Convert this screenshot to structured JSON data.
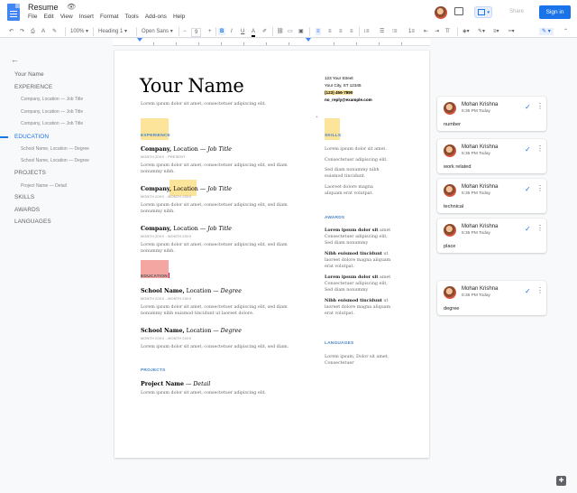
{
  "app": {
    "doc_title": "Resume",
    "menu": [
      "File",
      "Edit",
      "View",
      "Insert",
      "Format",
      "Tools",
      "Add-ons",
      "Help"
    ],
    "share_label": "Share",
    "signin_label": "Sign in"
  },
  "toolbar": {
    "zoom": "100%",
    "style": "Heading 1",
    "font": "Open Sans",
    "size": "9"
  },
  "outline": {
    "items": [
      {
        "label": "Your Name",
        "level": "h",
        "active": false
      },
      {
        "label": "EXPERIENCE",
        "level": "h",
        "active": false
      },
      {
        "label": "Company, Location — Job Title",
        "level": "s",
        "active": false
      },
      {
        "label": "Company, Location — Job Title",
        "level": "s",
        "active": false
      },
      {
        "label": "Company, Location — Job Title",
        "level": "s",
        "active": false
      },
      {
        "label": "EDUCATION",
        "level": "h",
        "active": true
      },
      {
        "label": "School Name, Location — Degree",
        "level": "s",
        "active": false
      },
      {
        "label": "School Name, Location — Degree",
        "level": "s",
        "active": false
      },
      {
        "label": "PROJECTS",
        "level": "h",
        "active": false
      },
      {
        "label": "Project Name — Detail",
        "level": "s",
        "active": false
      },
      {
        "label": "SKILLS",
        "level": "h",
        "active": false
      },
      {
        "label": "AWARDS",
        "level": "h",
        "active": false
      },
      {
        "label": "LANGUAGES",
        "level": "h",
        "active": false
      }
    ]
  },
  "doc": {
    "name": "Your Name",
    "tagline": "Lorem ipsum dolor sit amet, consectetuer adipiscing elit.",
    "contact": [
      "123 Your Street",
      "Your City, ST 12345",
      "(123) 456-7890",
      "no_reply@example.com"
    ],
    "experience_head": "EXPERIENCE",
    "jobs": [
      {
        "company": "Company,",
        "location": "Location",
        "sep": "—",
        "title": "Job Title",
        "date": "MONTH 20XX - PRESENT",
        "body": [
          "Lorem ipsum dolor sit amet, consectetuer adipiscing elit, sed diam",
          "nonummy nibh."
        ]
      },
      {
        "company": "Company,",
        "location": "Location",
        "sep": "—",
        "title": "Job Title",
        "date": "MONTH 20XX - MONTH 20XX",
        "body": [
          "Lorem ipsum dolor sit amet, consectetuer adipiscing elit, sed diam",
          "nonummy nibh."
        ]
      },
      {
        "company": "Company,",
        "location": "Location",
        "sep": "—",
        "title": "Job Title",
        "date": "MONTH 20XX - MONTH 20XX",
        "body": [
          "Lorem ipsum dolor sit amet, consectetuer adipiscing elit, sed diam",
          "nonummy nibh."
        ]
      }
    ],
    "education_head": "EDUCATION",
    "schools": [
      {
        "school": "School Name,",
        "location": "Location",
        "sep": "—",
        "degree": "Degree",
        "date": "MONTH 20XX - MONTH 20XX",
        "body": [
          "Lorem ipsum dolor sit amet, consectetuer adipiscing elit, sed diam",
          "nonummy nibh euismod tincidunt ut laoreet dolore."
        ]
      },
      {
        "school": "School Name,",
        "location": "Location",
        "sep": "—",
        "degree": "Degree",
        "date": "MONTH 20XX - MONTH 20XX",
        "body": [
          "Lorem ipsum dolor sit amet, consectetuer adipiscing elit, sed diam."
        ]
      }
    ],
    "projects_head": "PROJECTS",
    "project": {
      "name": "Project Name",
      "sep": "—",
      "detail": "Detail",
      "body": "Lorem ipsum dolor sit amet, consectetuer adipiscing elit."
    },
    "skills_head": "SKILLS",
    "skills": [
      "Lorem ipsum dolor sit amet.",
      "Consectetuer adipiscing elit.",
      "Sed diam nonummy nibh",
      "euismod tincidunt.",
      "Laoreet dolore magna",
      "aliquam erat volutpat."
    ],
    "awards_head": "AWARDS",
    "awards": [
      {
        "bold": "Lorem ipsum dolor sit",
        "rest": " amet",
        "lines": [
          "Consectetuer adipiscing elit,",
          "Sed diam nonummy"
        ]
      },
      {
        "bold": "Nibh euismod tincidunt",
        "rest": " ut",
        "lines": [
          "laoreet dolore magna aliquam",
          "erat volutpat."
        ]
      },
      {
        "bold": "Lorem ipsum dolor sit",
        "rest": " amet",
        "lines": [
          "Consectetuer adipiscing elit,",
          "Sed diam nonummy"
        ]
      },
      {
        "bold": "Nibh euismod tincidunt",
        "rest": " ut",
        "lines": [
          "laoreet dolore magna aliquam",
          "erat volutpat."
        ]
      }
    ],
    "languages_head": "LANGUAGES",
    "languages": [
      "Lorem ipsum, Dolor sit amet,",
      "Consectetuer"
    ]
  },
  "comments": [
    {
      "author": "Mohan Krishna",
      "time": "5:35 PM Today",
      "text": "number"
    },
    {
      "author": "Mohan Krishna",
      "time": "5:35 PM Today",
      "text": "work related"
    },
    {
      "author": "Mohan Krishna",
      "time": "5:35 PM Today",
      "text": "technical"
    },
    {
      "author": "Mohan Krishna",
      "time": "5:35 PM Today",
      "text": "place"
    },
    {
      "author": "Mohan Krishna",
      "time": "5:36 PM Today",
      "text": "degree"
    }
  ],
  "colors": {
    "accent": "#1a73e8",
    "highlight": "#fde49b",
    "comment_highlight": "#f4a6a3",
    "section_blue": "#4a86c8"
  }
}
